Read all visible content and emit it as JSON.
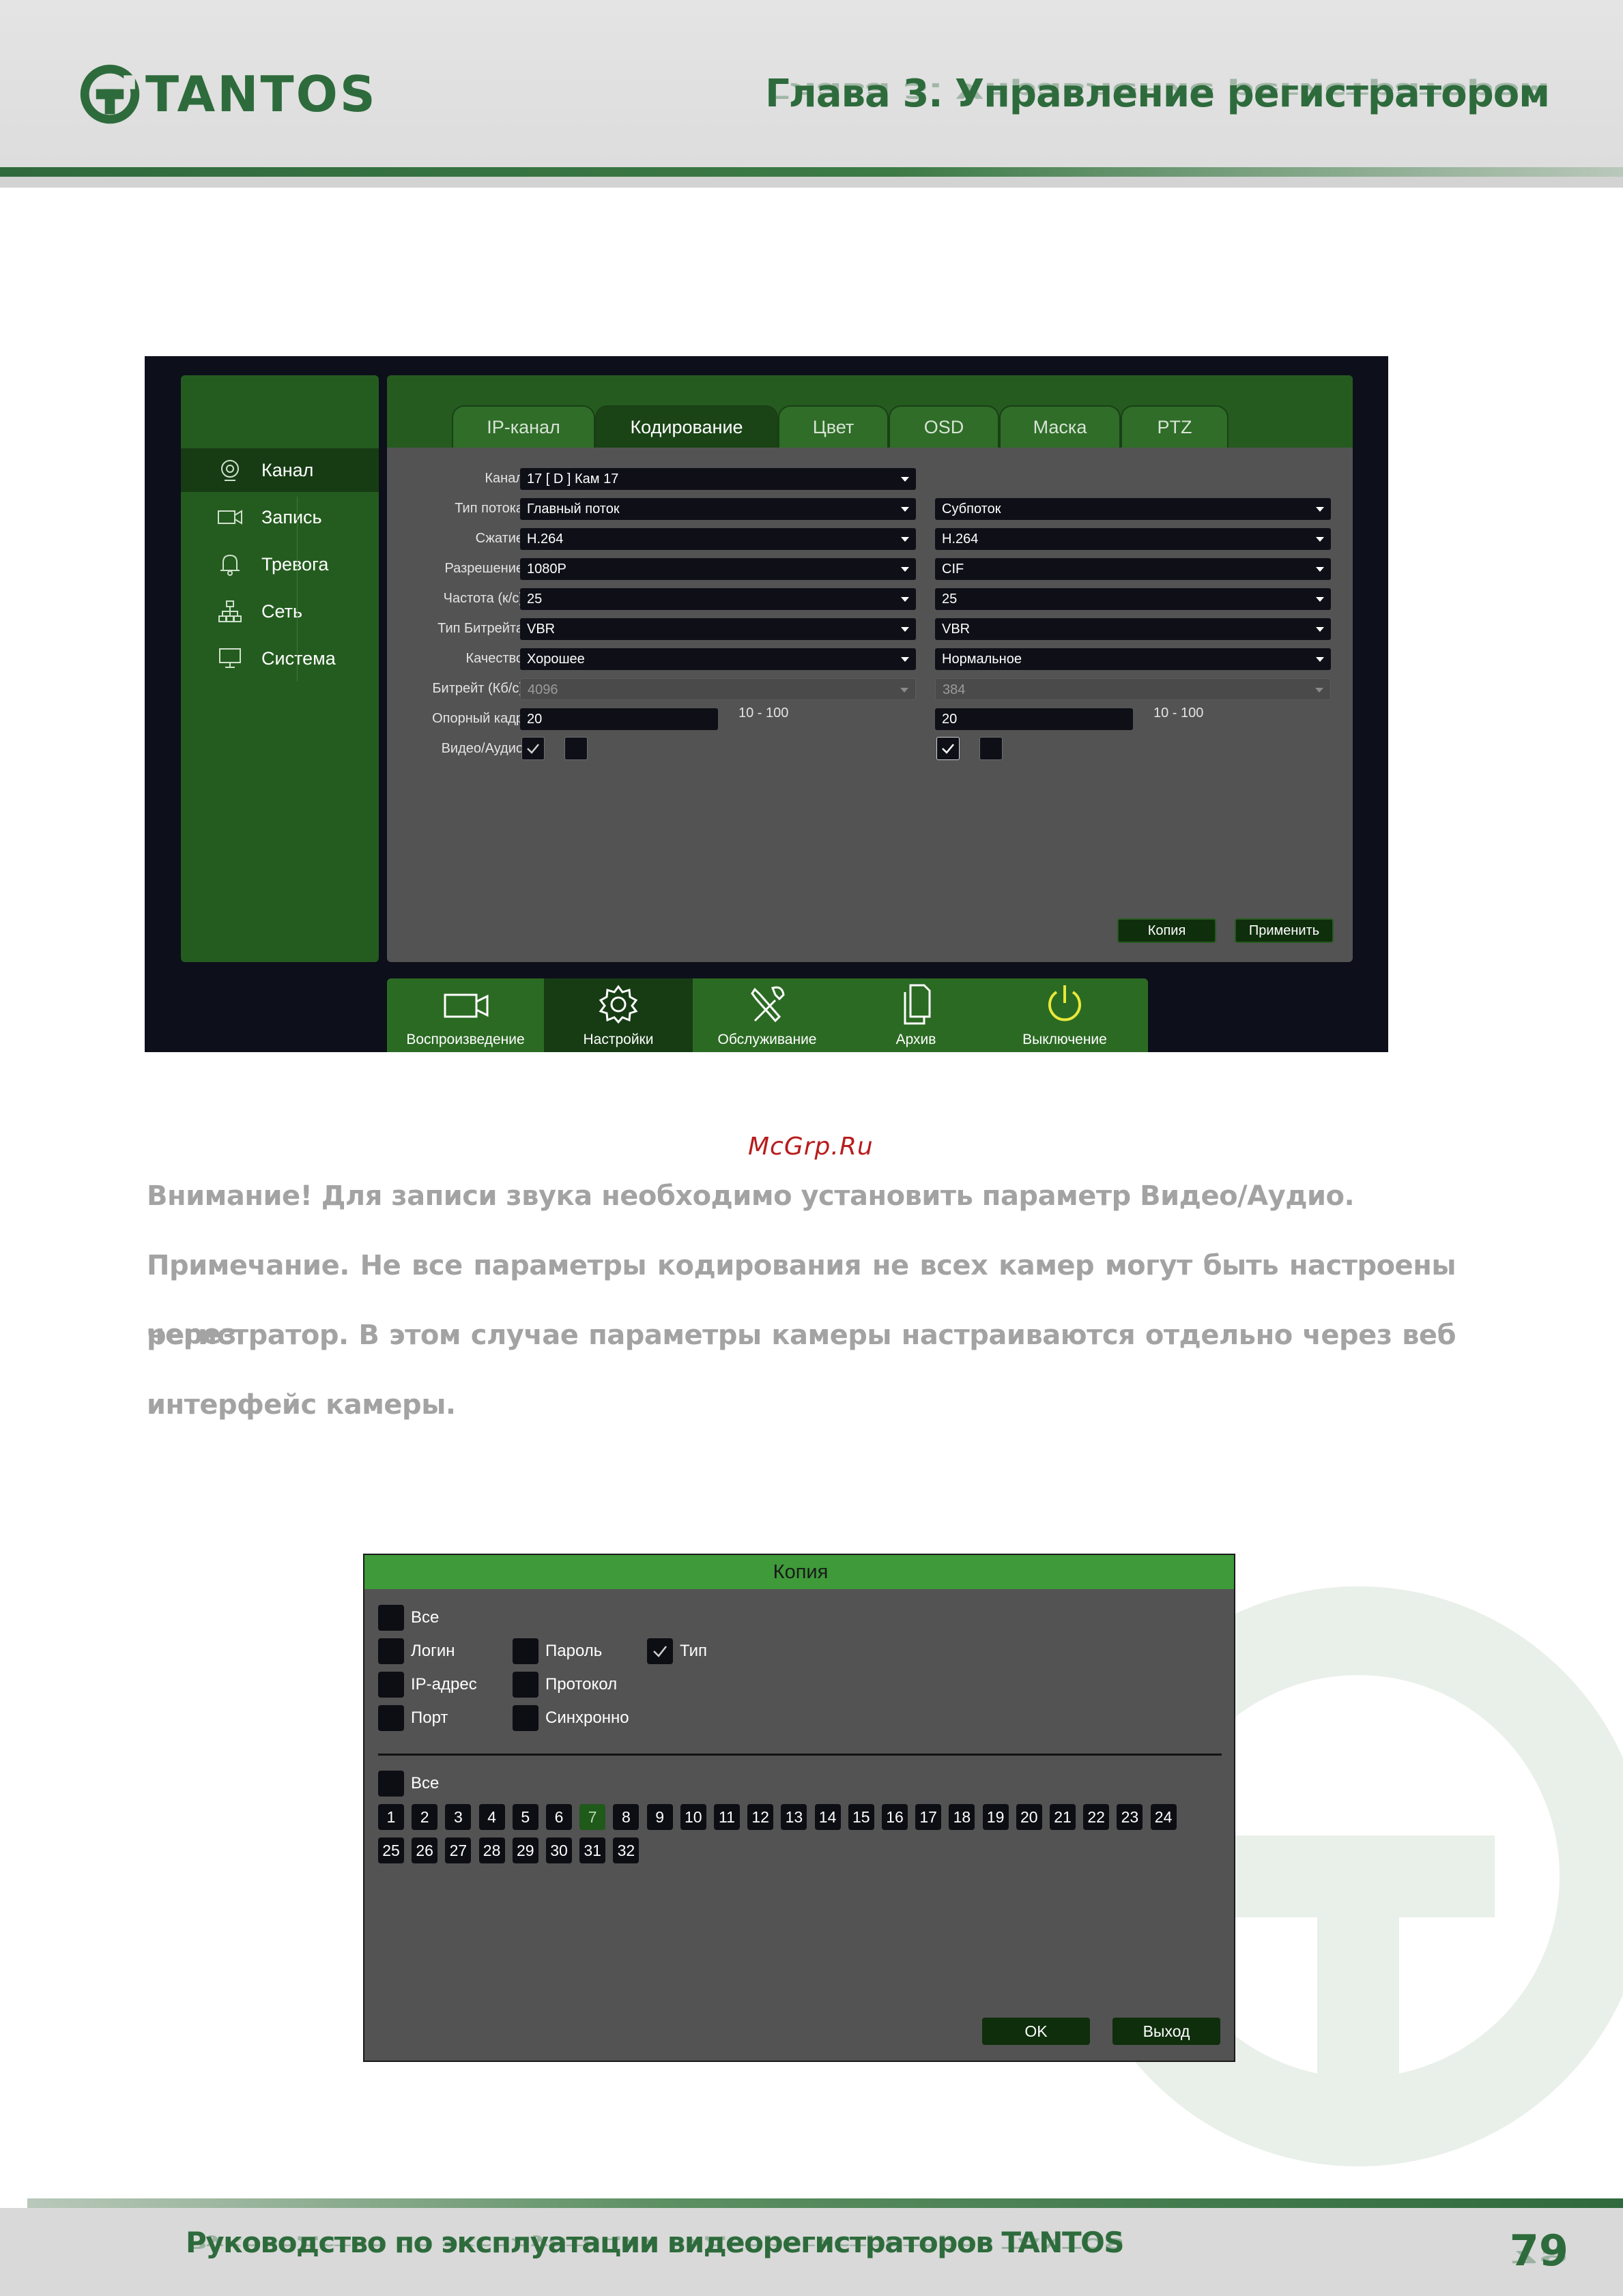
{
  "header": {
    "logo_text": "TANTOS",
    "chapter_title": "Глава 3. Управление регистратором"
  },
  "colors": {
    "brand_green": "#2e6b3c",
    "ui_green": "#255b1f",
    "ui_dark": "#0f0f18",
    "ui_panel": "#535353",
    "link_red": "#b71c1c"
  },
  "encoding_screen": {
    "sidebar": [
      {
        "label": "Канал",
        "icon": "camera-lens-icon",
        "active": true
      },
      {
        "label": "Запись",
        "icon": "video-camera-icon",
        "active": false
      },
      {
        "label": "Тревога",
        "icon": "bell-icon",
        "active": false
      },
      {
        "label": "Сеть",
        "icon": "network-icon",
        "active": false
      },
      {
        "label": "Система",
        "icon": "monitor-icon",
        "active": false
      }
    ],
    "tabs": [
      "IP-канал",
      "Кодирование",
      "Цвет",
      "OSD",
      "Маска",
      "PTZ"
    ],
    "active_tab": "Кодирование",
    "labels": {
      "channel": "Канал",
      "stream_type": "Тип потока",
      "compression": "Сжатие",
      "resolution": "Разрешение",
      "frame_rate": "Частота (к/с)",
      "bitrate_type": "Тип Битрейта",
      "quality": "Качество",
      "bitrate": "Битрейт (Кб/с)",
      "keyframe": "Опорный кадр",
      "video_audio": "Видео/Аудио"
    },
    "channel_value": "17 [ D ] Кам 17",
    "main_stream": {
      "stream_type": "Главный поток",
      "compression": "H.264",
      "resolution": "1080P",
      "frame_rate": "25",
      "bitrate_type": "VBR",
      "quality": "Хорошее",
      "bitrate": "4096",
      "keyframe": "20",
      "keyframe_range": "10 - 100",
      "video_checked": true,
      "audio_checked": false
    },
    "sub_stream": {
      "stream_type": "Субпоток",
      "compression": "H.264",
      "resolution": "CIF",
      "frame_rate": "25",
      "bitrate_type": "VBR",
      "quality": "Нормальное",
      "bitrate": "384",
      "keyframe": "20",
      "keyframe_range": "10 - 100",
      "video_checked": true,
      "audio_checked": false
    },
    "buttons": {
      "copy": "Копия",
      "apply": "Применить"
    },
    "bottom_bar": [
      {
        "label": "Воспроизведение",
        "icon": "playback-camera-icon",
        "active": false
      },
      {
        "label": "Настройки",
        "icon": "gear-icon",
        "active": true
      },
      {
        "label": "Обслуживание",
        "icon": "tools-icon",
        "active": false
      },
      {
        "label": "Архив",
        "icon": "documents-icon",
        "active": false
      },
      {
        "label": "Выключение",
        "icon": "power-icon",
        "active": false
      }
    ]
  },
  "body": {
    "site_link": "McGrp.Ru",
    "attention": "Внимание! Для записи звука необходимо установить параметр Видео/Аудио.",
    "note_line1": "Примечание. Не все параметры кодирования не всех камер могут быть настроены через",
    "note_line2": "регистратор. В этом случае параметры камеры настраиваются отдельно через веб",
    "note_line3": "интерфейс камеры."
  },
  "copy_dialog": {
    "title": "Копия",
    "param_all": "Все",
    "params": [
      {
        "label": "Логин",
        "checked": false
      },
      {
        "label": "Пароль",
        "checked": false
      },
      {
        "label": "Тип",
        "checked": true
      },
      {
        "label": "IP-адрес",
        "checked": false
      },
      {
        "label": "Протокол",
        "checked": false
      },
      {
        "label": "Порт",
        "checked": false
      },
      {
        "label": "Синхронно",
        "checked": false
      }
    ],
    "channel_all": "Все",
    "channels": [
      "1",
      "2",
      "3",
      "4",
      "5",
      "6",
      "7",
      "8",
      "9",
      "10",
      "11",
      "12",
      "13",
      "14",
      "15",
      "16",
      "17",
      "18",
      "19",
      "20",
      "21",
      "22",
      "23",
      "24",
      "25",
      "26",
      "27",
      "28",
      "29",
      "30",
      "31",
      "32"
    ],
    "selected_channel": "7",
    "buttons": {
      "ok": "OK",
      "exit": "Выход"
    }
  },
  "footer": {
    "manual_title": "Руководство по эксплуатации видеорегистраторов TANTOS",
    "page_number": "79"
  }
}
